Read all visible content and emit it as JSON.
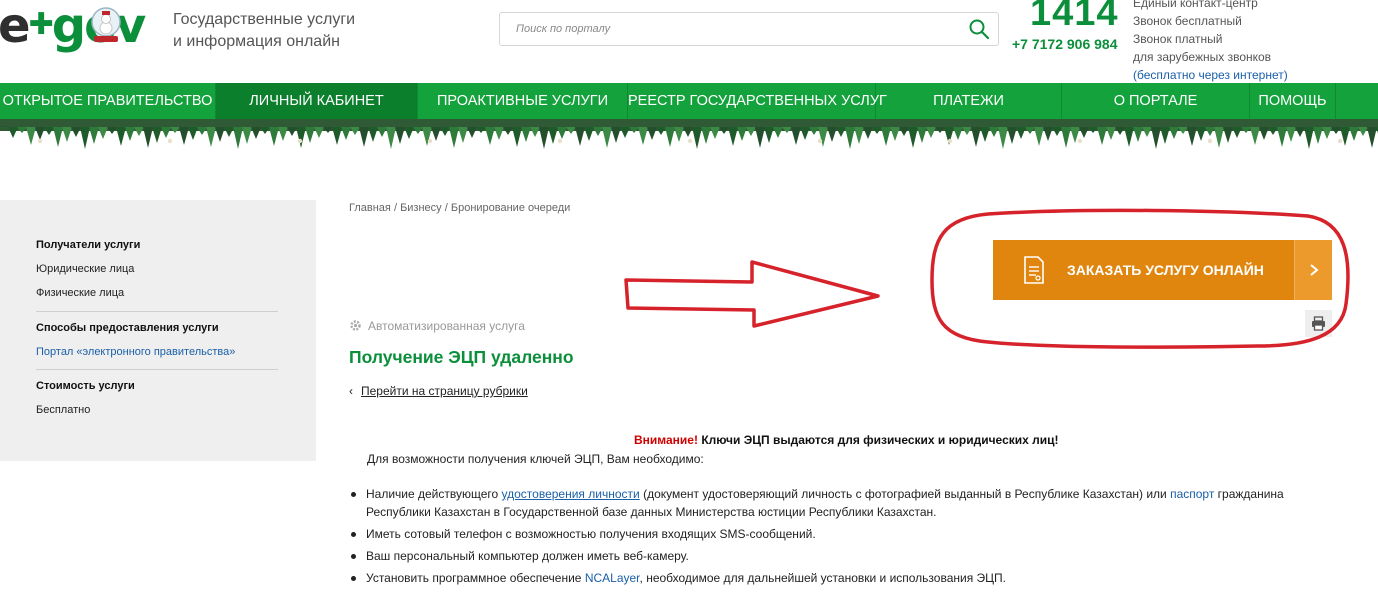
{
  "header": {
    "logo_text_e": "e",
    "logo_text_gov": "gov",
    "tagline_line1": "Государственные услуги",
    "tagline_line2": "и информация онлайн",
    "search_placeholder": "Поиск по порталу",
    "phone_big": "1414",
    "phone_small": "+7 7172 906 984",
    "contact_line1": "Единый контакт-центр",
    "contact_line2": "Звонок бесплатный",
    "contact_line3": "Звонок платный",
    "contact_line4": "для зарубежных звонков",
    "contact_link": "(бесплатно через интернет)"
  },
  "nav": {
    "items": [
      {
        "label": "ОТКРЫТОЕ ПРАВИТЕЛЬСТВО"
      },
      {
        "label": "ЛИЧНЫЙ КАБИНЕТ"
      },
      {
        "label": "ПРОАКТИВНЫЕ УСЛУГИ"
      },
      {
        "label": "РЕЕСТР ГОСУДАРСТВЕННЫХ УСЛУГ"
      },
      {
        "label": "ПЛАТЕЖИ"
      },
      {
        "label": "О ПОРТАЛЕ"
      },
      {
        "label": "ПОМОЩЬ"
      }
    ]
  },
  "sidebar": {
    "recipients_title": "Получатели услуги",
    "recipients": [
      "Юридические лица",
      "Физические лица"
    ],
    "methods_title": "Способы предоставления услуги",
    "methods": [
      "Портал «электронного правительства»"
    ],
    "cost_title": "Стоимость услуги",
    "cost_value": "Бесплатно"
  },
  "breadcrumb": {
    "home": "Главная",
    "business": "Бизнесу",
    "current": "Бронирование очереди",
    "separator": "/"
  },
  "service": {
    "order_button": "ЗАКАЗАТЬ УСЛУГУ ОНЛАЙН",
    "automated_label": "Автоматизированная услуга",
    "title": "Получение ЭЦП удаленно",
    "back_link": "Перейти на страницу рубрики"
  },
  "content": {
    "warning_label": "Внимание!",
    "warning_text": " Ключи ЭЦП выдаются для физических и юридических лиц!",
    "intro": "Для возможности получения ключей ЭЦП, Вам необходимо:",
    "item1_before": "Наличие действующего ",
    "item1_link1": "удостоверения личности",
    "item1_middle": " (документ удостоверяющий личность с фотографией выданный в Республике Казахстан) или ",
    "item1_link2": "паспорт",
    "item1_after": " гражданина",
    "item1_line2": "Республики Казахстан в Государственной базе данных Министерства юстиции Республики Казахстан.",
    "item2": "Иметь сотовый телефон с возможностью получения входящих SMS-сообщений.",
    "item3": "Ваш персональный компьютер должен иметь веб-камеру.",
    "item4_before": "Установить программное обеспечение ",
    "item4_link": "NCALayer",
    "item4_after": ", необходимое для дальнейшей установки и использования ЭЦП."
  },
  "colors": {
    "brand_green": "#14a23c",
    "title_green": "#0b8f3a",
    "order_orange": "#e0860f",
    "link_blue": "#1a5fa8",
    "annotation_red": "#d6222a"
  }
}
